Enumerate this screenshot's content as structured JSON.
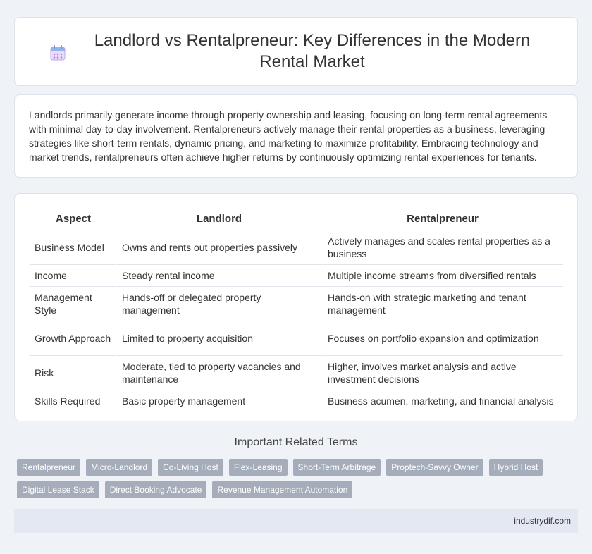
{
  "header": {
    "title": "Landlord vs Rentalpreneur: Key Differences in the Modern Rental Market",
    "icon": "calendar-icon"
  },
  "intro": {
    "text": "Landlords primarily generate income through property ownership and leasing, focusing on long-term rental agreements with minimal day-to-day involvement. Rentalpreneurs actively manage their rental properties as a business, leveraging strategies like short-term rentals, dynamic pricing, and marketing to maximize profitability. Embracing technology and market trends, rentalpreneurs often achieve higher returns by continuously optimizing rental experiences for tenants."
  },
  "table": {
    "headers": [
      "Aspect",
      "Landlord",
      "Rentalpreneur"
    ],
    "rows": [
      [
        "Business Model",
        "Owns and rents out properties passively",
        "Actively manages and scales rental properties as a business"
      ],
      [
        "Income",
        "Steady rental income",
        "Multiple income streams from diversified rentals"
      ],
      [
        "Management Style",
        "Hands-off or delegated property management",
        "Hands-on with strategic marketing and tenant management"
      ],
      [
        "Growth Approach",
        "Limited to property acquisition",
        "Focuses on portfolio expansion and optimization"
      ],
      [
        "Risk",
        "Moderate, tied to property vacancies and maintenance",
        "Higher, involves market analysis and active investment decisions"
      ],
      [
        "Skills Required",
        "Basic property management",
        "Business acumen, marketing, and financial analysis"
      ]
    ]
  },
  "related": {
    "title": "Important Related Terms",
    "tags": [
      "Rentalpreneur",
      "Micro-Landlord",
      "Co-Living Host",
      "Flex-Leasing",
      "Short-Term Arbitrage",
      "Proptech-Savvy Owner",
      "Hybrid Host",
      "Digital Lease Stack",
      "Direct Booking Advocate",
      "Revenue Management Automation"
    ]
  },
  "footer": {
    "site": "industrydif.com"
  }
}
